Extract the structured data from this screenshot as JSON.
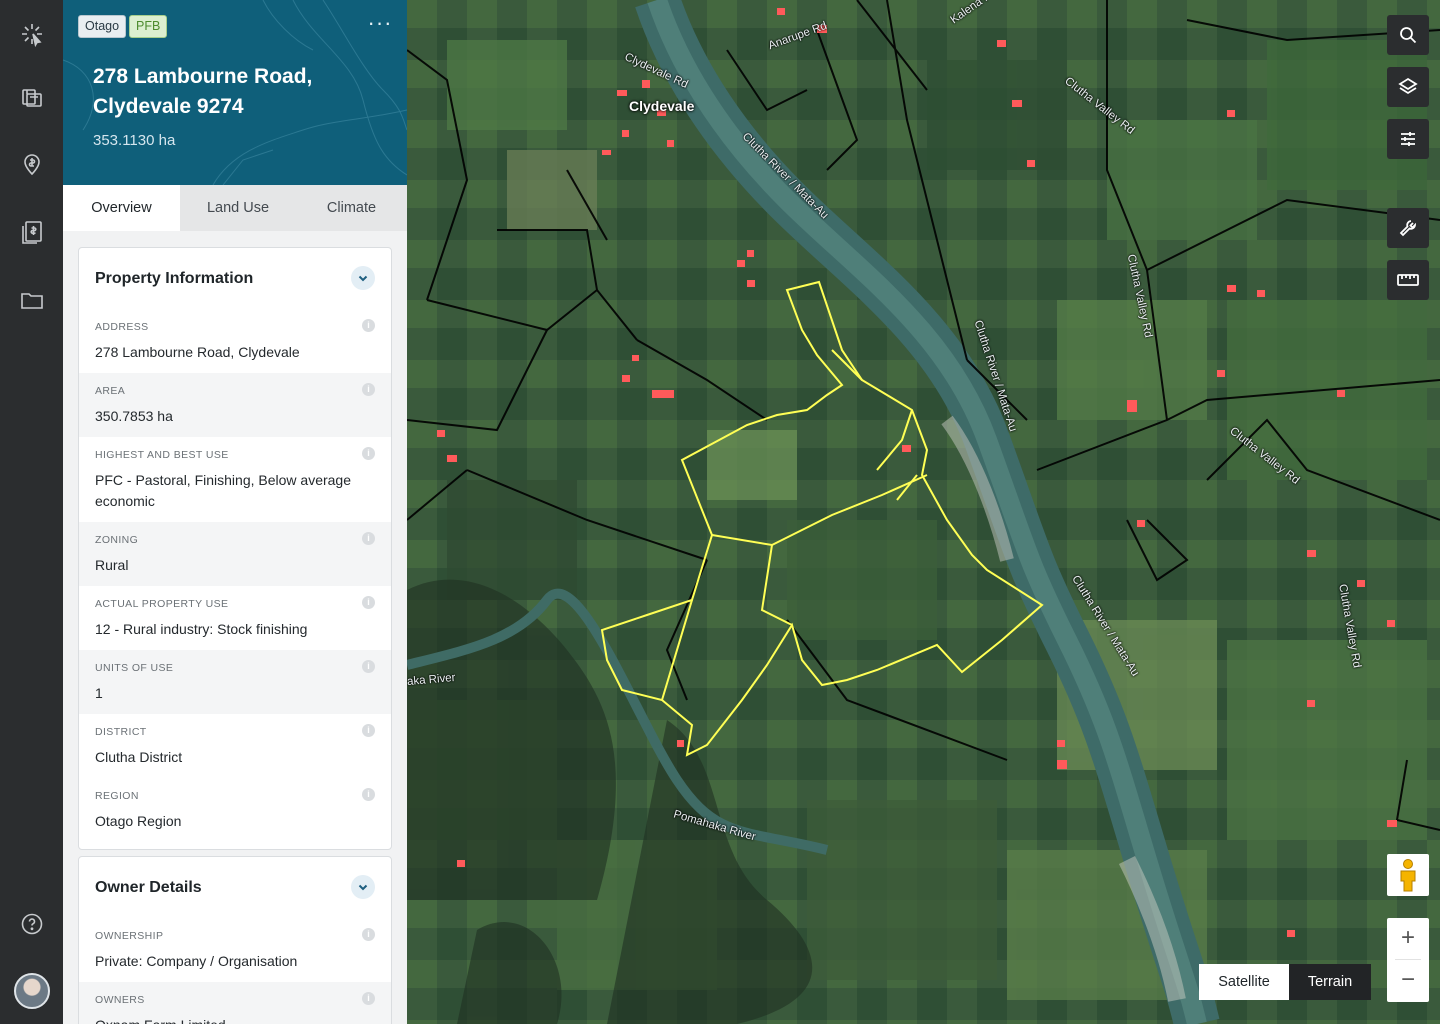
{
  "nav": {
    "items": [
      {
        "name": "logo-icon"
      },
      {
        "name": "properties-icon"
      },
      {
        "name": "location-pin-icon"
      },
      {
        "name": "valuation-report-icon"
      },
      {
        "name": "folder-icon"
      }
    ],
    "help_icon": "help-icon",
    "avatar": "user-avatar"
  },
  "property": {
    "region_badge": "Otago",
    "pfb_badge": "PFB",
    "more_label": "···",
    "title": "278 Lambourne Road, Clydevale 9274",
    "area": "353.1130 ha"
  },
  "tabs": [
    {
      "label": "Overview",
      "active": true
    },
    {
      "label": "Land Use",
      "active": false
    },
    {
      "label": "Climate",
      "active": false
    }
  ],
  "property_info": {
    "title": "Property Information",
    "rows": [
      {
        "label": "ADDRESS",
        "value": "278 Lambourne Road, Clydevale"
      },
      {
        "label": "AREA",
        "value": "350.7853 ha"
      },
      {
        "label": "HIGHEST AND BEST USE",
        "value": "PFC - Pastoral, Finishing, Below average economic"
      },
      {
        "label": "ZONING",
        "value": "Rural"
      },
      {
        "label": "ACTUAL PROPERTY USE",
        "value": "12 - Rural industry: Stock finishing"
      },
      {
        "label": "UNITS OF USE",
        "value": "1"
      },
      {
        "label": "DISTRICT",
        "value": "Clutha District"
      },
      {
        "label": "REGION",
        "value": "Otago Region"
      }
    ]
  },
  "owner_details": {
    "title": "Owner Details",
    "rows": [
      {
        "label": "OWNERSHIP",
        "value": "Private: Company / Organisation"
      },
      {
        "label": "OWNERS",
        "value": "Oxnam Farm Limited"
      }
    ]
  },
  "map": {
    "town": "Clydevale",
    "labels": {
      "river1": "Clutha River / Mata-Au",
      "river2": "Clutha River / Mata-Au",
      "river3": "Clutha River / Mata-Au",
      "pomahaka": "Pomahaka River",
      "pomahaka_left": "aka River",
      "clydevale_rd": "Clydevale Rd",
      "clutha_valley_rd": "Clutha Valley Rd",
      "clutha_valley_rd2": "Clutha Valley Rd",
      "clutha_valley_rd3": "Clutha Valley Rd",
      "clutha_valley_rd4": "Clutha Valley Rd",
      "anarupe_rd": "Anarupe Rd",
      "road_top": "Kalena Rd"
    },
    "map_types": {
      "satellite": "Satellite",
      "terrain": "Terrain"
    },
    "zoom_in": "+",
    "zoom_out": "−",
    "tools": [
      "search-icon",
      "layers-icon",
      "filter-sliders-icon",
      "wrench-icon",
      "ruler-icon"
    ],
    "parcel_color": "#ffff55"
  }
}
